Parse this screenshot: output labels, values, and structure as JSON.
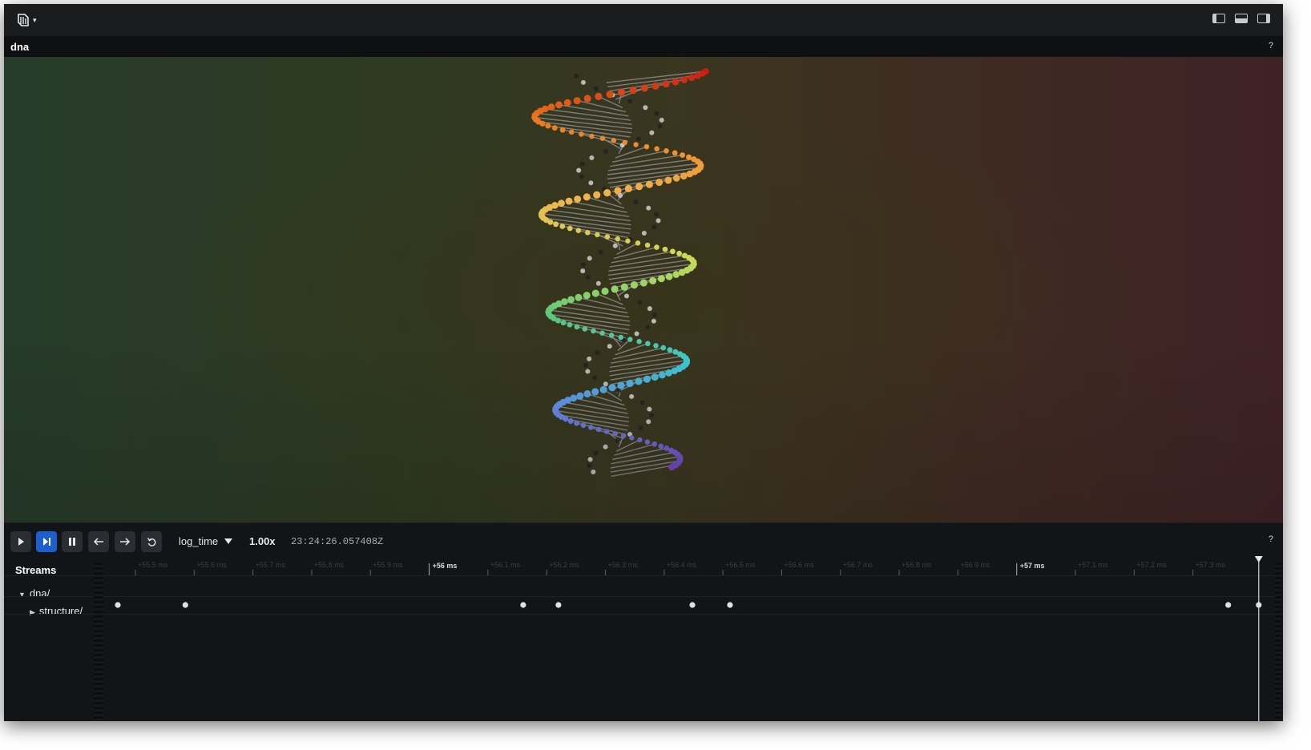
{
  "app": {
    "menu_caret": "▾"
  },
  "panel": {
    "title": "dna",
    "help": "?"
  },
  "layout_icons": [
    "left-panel-icon",
    "bottom-panel-icon",
    "right-panel-icon"
  ],
  "controls": {
    "buttons": [
      "play",
      "follow",
      "pause",
      "step-back",
      "step-forward",
      "loop"
    ],
    "timeline_selector": "log_time",
    "speed": "1.00x",
    "timestamp": "23:24:26.057408Z",
    "help": "?"
  },
  "timeline": {
    "streams_title": "Streams",
    "tree": [
      {
        "label": "dna/",
        "expanded": true,
        "arrow": "▼"
      },
      {
        "label": "structure/",
        "expanded": false,
        "arrow": "▶"
      }
    ],
    "major_ticks": [
      {
        "label": "+56 ms",
        "value": 56.0
      },
      {
        "label": "+57 ms",
        "value": 57.0
      }
    ],
    "range_ms": [
      55.455,
      57.415
    ],
    "minor_tick_step_ms": 0.1,
    "minor_tick_labels": [
      "+55.5 ms",
      "+55.6 ms",
      "+55.7 ms",
      "+55.8 ms",
      "+55.9 ms",
      "+56.1 ms",
      "+56.2 ms",
      "+56.3 ms",
      "+56.4 ms",
      "+56.5 ms",
      "+56.6 ms",
      "+56.7 ms",
      "+56.8 ms",
      "+56.9 ms",
      "+57.1 ms",
      "+57.2 ms",
      "+57.3 ms"
    ],
    "event_times_ms": [
      55.47,
      55.585,
      56.16,
      56.22,
      56.448,
      56.512,
      57.36,
      57.412
    ],
    "cursor_ms": 57.412
  },
  "colors": {
    "accent": "#1d5fd0",
    "helix_start": "#cc1f1f",
    "helix_end": "#6a4bb5"
  }
}
